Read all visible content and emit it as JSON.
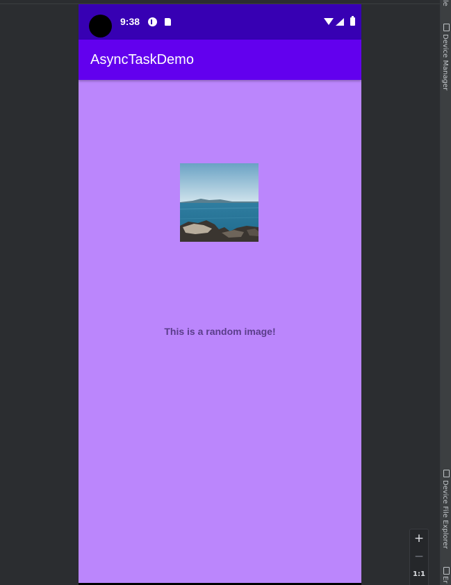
{
  "status_bar": {
    "time": "9:38"
  },
  "app": {
    "title": "AsyncTaskDemo",
    "image_caption": "This is a random image!"
  },
  "ide": {
    "right_strip": {
      "top_label_fragment": "le",
      "device_manager_label": "Device Manager",
      "device_file_explorer_label": "Device File Explorer",
      "bottom_label_fragment": "Er"
    },
    "zoom": {
      "in_label": "+",
      "out_label": "−",
      "actual_size_label": "1:1"
    }
  },
  "colors": {
    "status_bar": "#3700b3",
    "app_bar": "#6200ee",
    "background": "#bb86fc",
    "caption_text": "#5a3d8a",
    "ide_background": "#2b2d30"
  },
  "icons": [
    "camera-cutout",
    "notification-p-icon",
    "sd-card-icon",
    "wifi-icon",
    "cell-signal-icon",
    "battery-icon"
  ]
}
